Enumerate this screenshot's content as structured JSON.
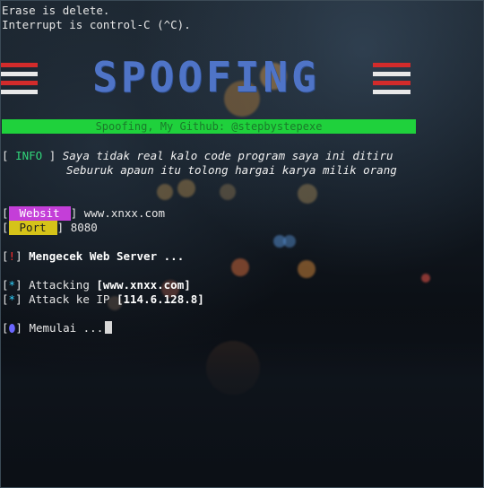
{
  "terminal": {
    "header_line1": "Erase is delete.",
    "header_line2": "Interrupt is control-C (^C).",
    "banner_title": "SPOOFING",
    "github_bar": "Spoofing, My Github: @stepbystepexe",
    "info_tag": "INFO",
    "info_line1": "Saya tidak real kalo code program saya ini ditiru",
    "info_line2": "Seburuk apaun itu tolong hargai karya milik orang",
    "website_label": "Websit",
    "website_value": "www.xnxx.com",
    "port_label": "Port",
    "port_value": "8080",
    "bang_symbol": "!",
    "check_text": "Mengecek Web Server ...",
    "star_symbol": "*",
    "attacking_prefix": "Attacking",
    "attacking_target": "[www.xnxx.com]",
    "attack_ip_prefix": "Attack ke IP",
    "attack_ip": "[114.6.128.8]",
    "start_text": "Memulai ..."
  },
  "colors": {
    "banner": "#4f74c7",
    "stripe_red": "#d22b2b",
    "stripe_white": "#e8e8e8",
    "green_bar": "#1fd13c",
    "info_green": "#31d67a",
    "website_magenta": "#c43ed8",
    "port_yellow": "#d5c319",
    "bang_red": "#ff2d2d",
    "star_cyan": "#32d3ff",
    "dot_blue": "#6a66ff"
  }
}
